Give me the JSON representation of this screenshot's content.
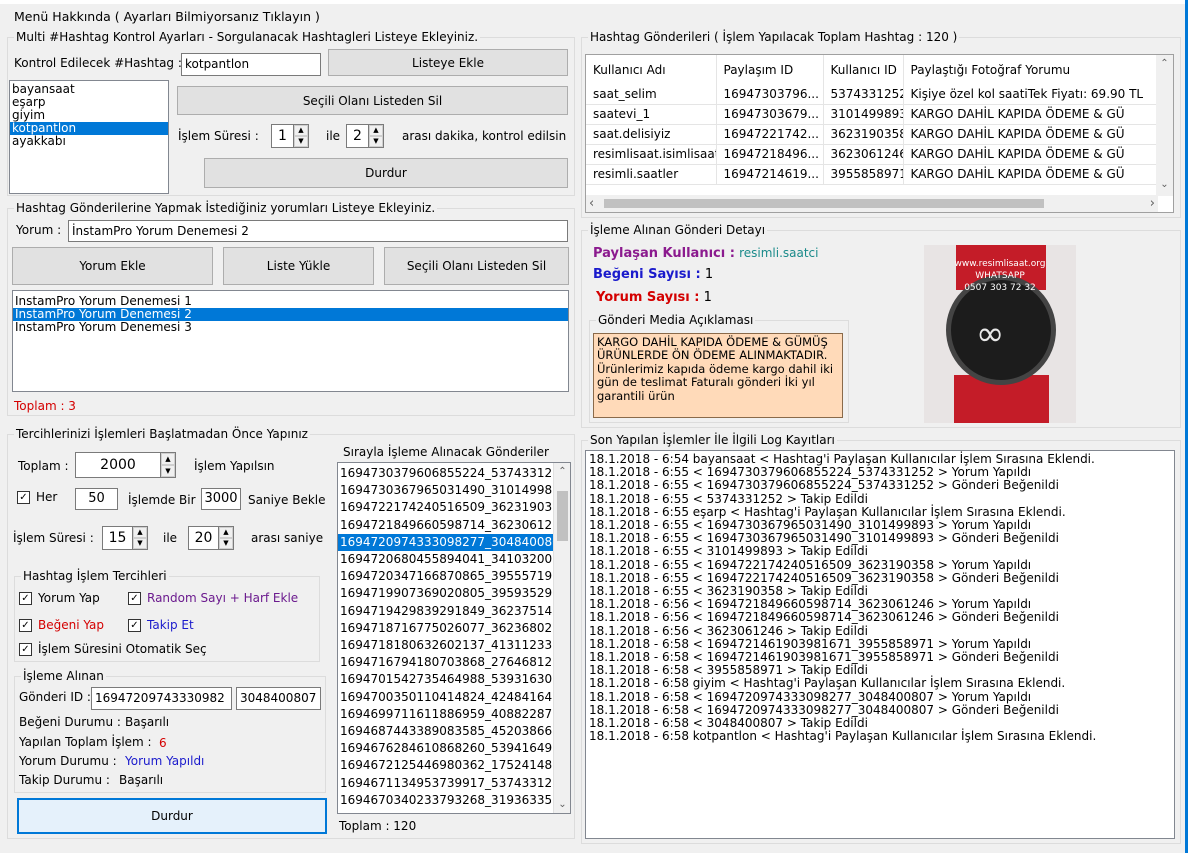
{
  "menu": {
    "about": "Menü Hakkında ( Ayarları Bilmiyorsanız Tıklayın )"
  },
  "hashtag_settings": {
    "group_title": "Multi #Hashtag Kontrol Ayarları - Sorgulanacak Hashtagleri Listeye Ekleyiniz.",
    "hashtag_label": "Kontrol Edilecek #Hashtag :",
    "hashtag_value": "kotpantlon",
    "add_button": "Listeye Ekle",
    "remove_button": "Seçili Olanı Listeden Sil",
    "stop_button": "Durdur",
    "duration_label": "İşlem Süresi :",
    "duration_from": "1",
    "and_label": "ile",
    "duration_to": "2",
    "duration_suffix": "arası dakika, kontrol edilsin",
    "hashtags": [
      "bayansaat",
      "eşarp",
      "giyim",
      "kotpantlon",
      "ayakkabı"
    ]
  },
  "comments": {
    "group_title": "Hashtag Gönderilerine Yapmak İstediğiniz yorumları Listeye Ekleyiniz.",
    "comment_label": "Yorum :",
    "comment_value": "İnstamPro Yorum Denemesi 2",
    "add_button": "Yorum Ekle",
    "load_button": "Liste Yükle",
    "remove_button": "Seçili Olanı Listeden Sil",
    "items": [
      "İnstamPro Yorum Denemesi 1",
      "İnstamPro Yorum Denemesi 2",
      "İnstamPro Yorum Denemesi 3"
    ],
    "total": "Toplam : 3"
  },
  "prefs": {
    "group_title": "Tercihlerinizi İşlemleri Başlatmadan Önce Yapınız",
    "total_label": "Toplam :",
    "total_value": "2000",
    "total_suffix": "İşlem Yapılsın",
    "every_label": "Her",
    "every_value": "50",
    "every_mid": "İşlemde Bir",
    "wait_value": "3000",
    "wait_suffix": "Saniye Bekle",
    "duration_label": "İşlem Süresi :",
    "duration_from": "15",
    "and_label": "ile",
    "duration_to": "20",
    "duration_suffix": "arası saniye",
    "options_title": "Hashtag İşlem Tercihleri",
    "opt_comment": "Yorum Yap",
    "opt_random": "Random Sayı + Harf Ekle",
    "opt_like": "Beğeni Yap",
    "opt_follow": "Takip Et",
    "opt_auto": "İşlem Süresini Otomatik Seç",
    "colors": {
      "random": "#6b1a8e",
      "like": "#d40000",
      "follow": "#1a1acc",
      "count": "#d40000",
      "comment_status": "#1a1acc"
    },
    "taken_title": "İşleme Alınan",
    "post_id_label": "Gönderi ID :",
    "post_id_value": "16947209743330982",
    "user_id_value": "3048400807",
    "like_status_label": "Beğeni Durumu :",
    "like_status_value": "Başarılı",
    "done_label": "Yapılan Toplam İşlem :",
    "done_value": "6",
    "comment_status_label": "Yorum Durumu :",
    "comment_status_value": "Yorum Yapıldı",
    "follow_status_label": "Takip Durumu :",
    "follow_status_value": "Başarılı",
    "stop_button": "Durdur"
  },
  "queue": {
    "title": "Sırayla İşleme Alınacak Gönderiler",
    "items": [
      "1694730379606855224_53743312",
      "1694730367965031490_31014998",
      "1694722174240516509_36231903",
      "1694721849660598714_36230612",
      "1694720974333098277_3048400807",
      "1694720680455894041_34103200",
      "1694720347166870865_39555719",
      "1694719907369020805_39593529",
      "1694719429839291849_36237514",
      "1694718716775026077_36236802",
      "1694718180632602137_41311233",
      "1694716794180703868_27646812",
      "1694701542735464988_53931630",
      "1694700350110414824_42484164",
      "1694699711611886959_40882287",
      "1694687443389083585_45203866",
      "1694676284610868260_53941649",
      "1694672125446980362_17524148",
      "1694671134953739917_53743312",
      "1694670340233793268_31936335"
    ],
    "selected_index": 4,
    "total": "Toplam :  120"
  },
  "posts": {
    "group_title": "Hashtag Gönderileri ( İşlem Yapılacak Toplam Hashtag : 120 )",
    "columns": [
      "Kullanıcı Adı",
      "Paylaşım ID",
      "Kullanıcı ID",
      "Paylaştığı Fotoğraf Yorumu"
    ],
    "rows": [
      [
        "saat_selim",
        "16947303796...",
        "5374331252",
        "Kişiye özel kol saatiTek Fiyatı: 69.90 TL"
      ],
      [
        "saatevi_1",
        "16947303679...",
        "3101499893",
        "KARGO DAHİL KAPIDA ÖDEME & GÜ"
      ],
      [
        "saat.delisiyiz",
        "16947221742...",
        "3623190358",
        "KARGO DAHİL KAPIDA ÖDEME & GÜ"
      ],
      [
        "resimlisaat.isimlisaat",
        "16947218496...",
        "3623061246",
        "KARGO DAHİL KAPIDA ÖDEME & GÜ"
      ],
      [
        "resimli.saatler",
        "16947214619...",
        "3955858971",
        "KARGO DAHİL KAPIDA ÖDEME & GÜ"
      ]
    ]
  },
  "detail": {
    "group_title": "İşleme Alınan Gönderi Detayı",
    "sharer_label": "Paylaşan Kullanıcı",
    "sharer_value": "resimli.saatci",
    "likes_label": "Beğeni Sayısı",
    "likes_value": "1",
    "comments_label": "Yorum Sayısı",
    "comments_value": "1",
    "colors": {
      "sharer": "#8b1a8e",
      "sharer_value": "#1a8a8a",
      "likes": "#1a1acc",
      "comments": "#d40000"
    },
    "media_title": "Gönderi Media Açıklaması",
    "media_text": "KARGO DAHİL KAPIDA ÖDEME & GÜMÜŞ ÜRÜNLERDE ÖN ÖDEME ALINMAKTADIR. Ürünlerimiz kapıda ödeme kargo dahil iki gün de teslimat Faturalı gönderi İki yıl garantili ürün",
    "image_watermark": [
      "www.resimlisaat.org",
      "WHATSAPP",
      "0507 303 72 32"
    ]
  },
  "log": {
    "group_title": "Son Yapılan İşlemler İle İlgili Log Kayıtları",
    "lines": [
      "18.1.2018 - 6:54 bayansaat < Hashtag'i Paylaşan Kullanıcılar İşlem Sırasına Eklendi.",
      "18.1.2018 - 6:55 < 1694730379606855224_5374331252 > Yorum Yapıldı",
      "18.1.2018 - 6:55 < 1694730379606855224_5374331252 > Gönderi Beğenildi",
      "18.1.2018 - 6:55 < 5374331252 > Takip Edildi",
      "18.1.2018 - 6:55 eşarp < Hashtag'i Paylaşan Kullanıcılar İşlem Sırasına Eklendi.",
      "18.1.2018 - 6:55 < 1694730367965031490_3101499893 > Yorum Yapıldı",
      "18.1.2018 - 6:55 < 1694730367965031490_3101499893 > Gönderi Beğenildi",
      "18.1.2018 - 6:55 < 3101499893 > Takip Edildi",
      "18.1.2018 - 6:55 < 1694722174240516509_3623190358 > Yorum Yapıldı",
      "18.1.2018 - 6:55 < 1694722174240516509_3623190358 > Gönderi Beğenildi",
      "18.1.2018 - 6:55 < 3623190358 > Takip Edildi",
      "18.1.2018 - 6:56 < 1694721849660598714_3623061246 > Yorum Yapıldı",
      "18.1.2018 - 6:56 < 1694721849660598714_3623061246 > Gönderi Beğenildi",
      "18.1.2018 - 6:56 < 3623061246 > Takip Edildi",
      "18.1.2018 - 6:58 < 1694721461903981671_3955858971 > Yorum Yapıldı",
      "18.1.2018 - 6:58 < 1694721461903981671_3955858971 > Gönderi Beğenildi",
      "18.1.2018 - 6:58 < 3955858971 > Takip Edildi",
      "18.1.2018 - 6:58 giyim < Hashtag'i Paylaşan Kullanıcılar İşlem Sırasına Eklendi.",
      "18.1.2018 - 6:58 < 1694720974333098277_3048400807 > Yorum Yapıldı",
      "18.1.2018 - 6:58 < 1694720974333098277_3048400807 > Gönderi Beğenildi",
      "18.1.2018 - 6:58 < 3048400807 > Takip Edildi",
      "18.1.2018 - 6:58 kotpantlon < Hashtag'i Paylaşan Kullanıcılar İşlem Sırasına Eklendi."
    ]
  }
}
